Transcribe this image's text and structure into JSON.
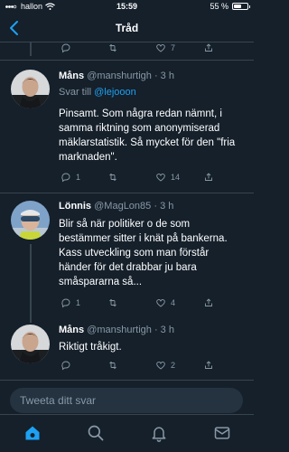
{
  "status_bar": {
    "carrier": "hallon",
    "time": "15:59",
    "battery": "55 %",
    "battery_level": 0.55
  },
  "header": {
    "title": "Tråd"
  },
  "top_actions": {
    "retweets": "",
    "likes": "7"
  },
  "tweets": [
    {
      "name": "Måns",
      "handle": "@manshurtigh",
      "time": "· 3 h",
      "reply_prefix": "Svar till",
      "reply_to": "@lejooon",
      "text": "Pinsamt. Som några redan nämnt, i samma riktning som anonymiserad mäklarstatistik. Så mycket för den \"fria marknaden\".",
      "replies": "1",
      "retweets": "",
      "likes": "14"
    },
    {
      "name": "Lönnis",
      "handle": "@MagLon85",
      "time": "· 3 h",
      "text": "Blir så när politiker o de som bestämmer sitter i knät på bankerna. Kass utveckling som man förstår händer för det drabbar ju bara småspararna så...",
      "replies": "1",
      "retweets": "",
      "likes": "4"
    },
    {
      "name": "Måns",
      "handle": "@manshurtigh",
      "time": "· 3 h",
      "text": "Riktigt tråkigt.",
      "replies": "",
      "retweets": "",
      "likes": "2"
    }
  ],
  "composer": {
    "placeholder": "Tweeta ditt svar"
  },
  "colors": {
    "background": "#15202b",
    "accent": "#1da1f2",
    "muted": "#8899a6",
    "border": "#38444d"
  },
  "icons": [
    "wifi-icon",
    "back-chevron-icon",
    "reply-icon",
    "retweet-icon",
    "like-icon",
    "share-icon",
    "home-icon",
    "search-icon",
    "notifications-icon",
    "messages-icon"
  ]
}
